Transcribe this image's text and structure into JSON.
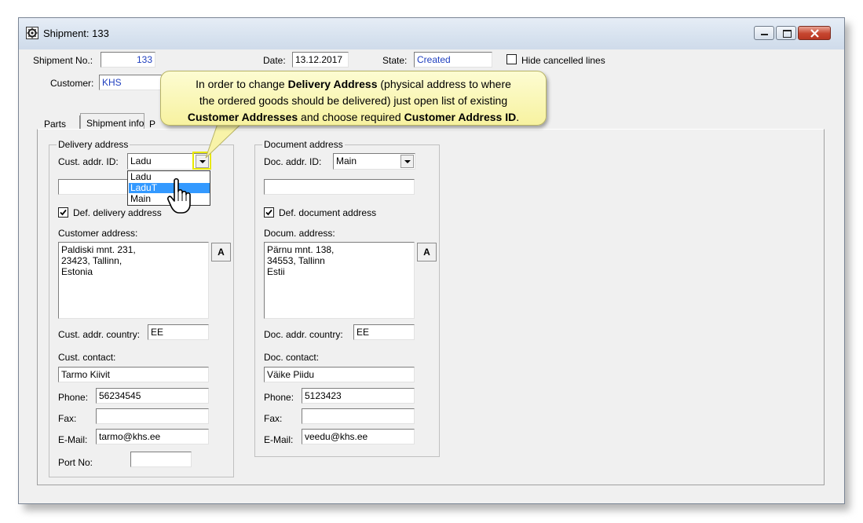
{
  "window": {
    "title": "Shipment: 133"
  },
  "header": {
    "shipment_no_label": "Shipment No.:",
    "shipment_no": "133",
    "date_label": "Date:",
    "date": "13.12.2017",
    "state_label": "State:",
    "state": "Created",
    "hide_cancelled_label": "Hide cancelled lines",
    "customer_label": "Customer:",
    "customer": "KHS"
  },
  "tabs": [
    "Parts",
    "Shipment info",
    "P"
  ],
  "delivery": {
    "group_title": "Delivery address",
    "addr_id_label": "Cust. addr. ID:",
    "addr_id": "Ladu",
    "dropdown_options": [
      "Ladu",
      "LaduT",
      "Main"
    ],
    "dropdown_selected": "LaduT",
    "def_label": "Def. delivery address",
    "address_label": "Customer address:",
    "address_lines": [
      "Paldiski mnt. 231,",
      "23423, Tallinn,",
      "Estonia"
    ],
    "a_button": "A",
    "country_label": "Cust. addr. country:",
    "country": "EE",
    "contact_label": "Cust. contact:",
    "contact": "Tarmo Kiivit",
    "phone_label": "Phone:",
    "phone": "56234545",
    "fax_label": "Fax:",
    "fax": "",
    "email_label": "E-Mail:",
    "email": "tarmo@khs.ee",
    "port_label": "Port No:",
    "port": ""
  },
  "document": {
    "group_title": "Document address",
    "addr_id_label": "Doc. addr. ID:",
    "addr_id": "Main",
    "def_label": "Def. document address",
    "address_label": "Docum. address:",
    "address_lines": [
      "Pärnu mnt. 138,",
      "34553, Tallinn",
      "Estii"
    ],
    "a_button": "A",
    "country_label": "Doc. addr. country:",
    "country": "EE",
    "contact_label": "Doc. contact:",
    "contact": "Väike Piidu",
    "phone_label": "Phone:",
    "phone": "5123423",
    "fax_label": "Fax:",
    "fax": "",
    "email_label": "E-Mail:",
    "email": "veedu@khs.ee"
  },
  "callout": {
    "p1": "In order to change ",
    "b1": "Delivery Address",
    "p2": " (physical address to where",
    "line2": "the ordered goods should be delivered) just open list of existing",
    "b2": "Customer Addresses",
    "p3": " and choose required ",
    "b3": "Customer Address ID",
    "p4": "."
  },
  "colors": {
    "accent": "#1f3fbf",
    "selection": "#3399ff",
    "callout": "#f7f2a0"
  }
}
